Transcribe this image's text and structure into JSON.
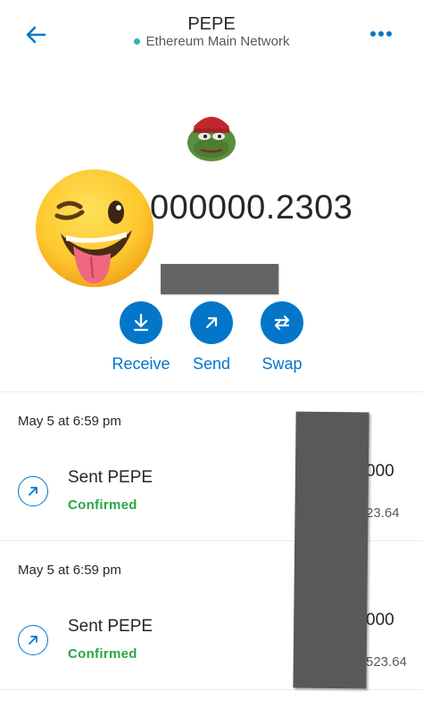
{
  "header": {
    "title": "PEPE",
    "network": "Ethereum Main Network",
    "back_icon": "arrow-left-icon",
    "more_icon": "more-horizontal-icon"
  },
  "token": {
    "balance": "000000.2303",
    "logo_icon": "pepe-frog-icon"
  },
  "actions": [
    {
      "label": "Receive",
      "icon": "download-icon"
    },
    {
      "label": "Send",
      "icon": "arrow-up-right-icon"
    },
    {
      "label": "Swap",
      "icon": "swap-icon"
    }
  ],
  "transactions": [
    {
      "date": "May 5 at 6:59 pm",
      "title": "Sent PEPE",
      "status": "Confirmed",
      "amount": "000",
      "fiat": "23.64"
    },
    {
      "date": "May 5 at 6:59 pm",
      "title": "Sent PEPE",
      "status": "Confirmed",
      "amount": "000",
      "fiat": "523.64"
    }
  ],
  "colors": {
    "primary": "#0376c9",
    "success": "#28a745",
    "network_dot": "#29b6af",
    "redaction": "#59595b"
  }
}
